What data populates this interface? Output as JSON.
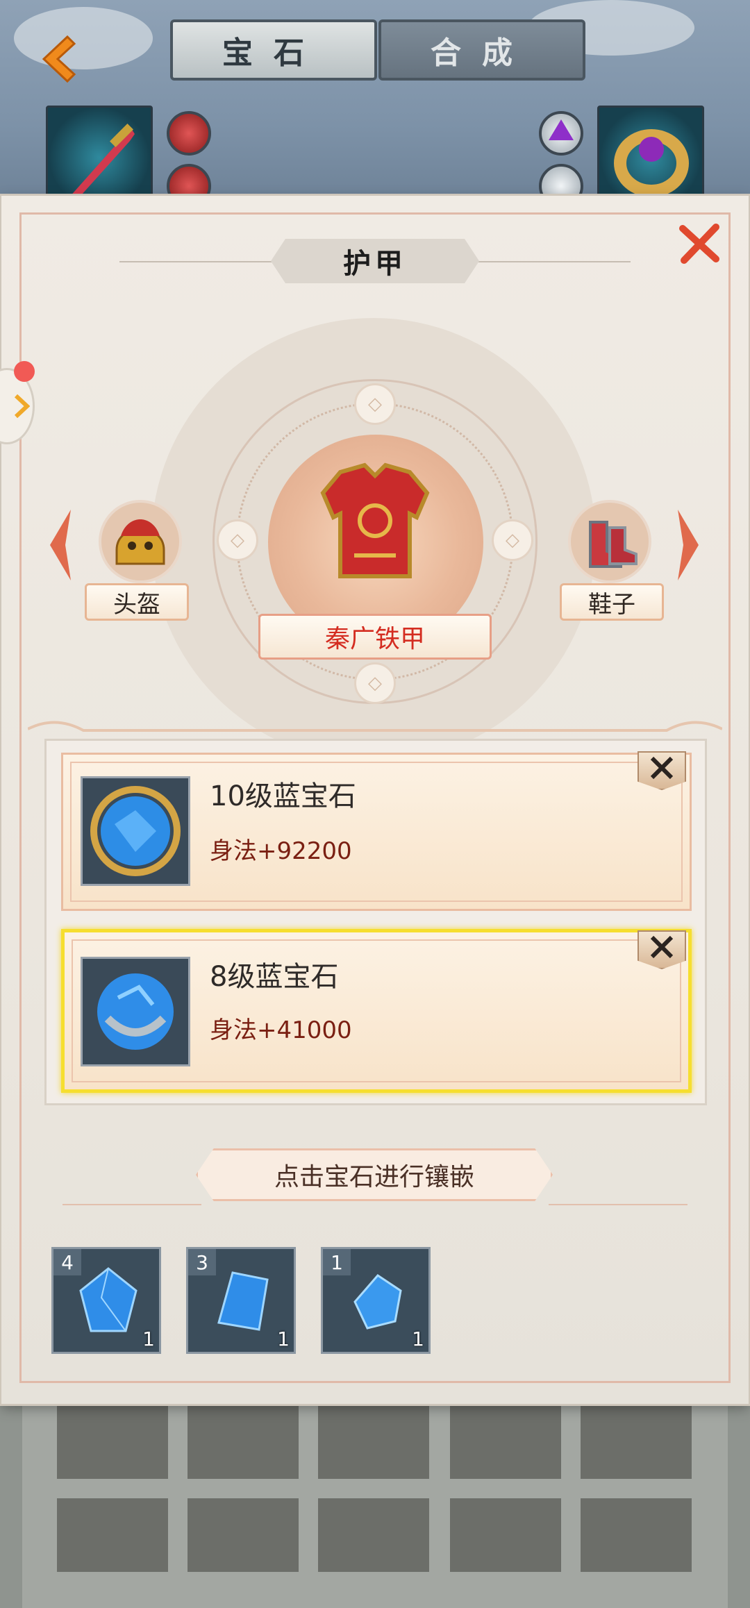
{
  "header": {
    "tabs": [
      {
        "label": "宝石",
        "active": true
      },
      {
        "label": "合成",
        "active": false
      }
    ]
  },
  "panel": {
    "title": "护甲",
    "equipment": {
      "prev": {
        "label": "头盔"
      },
      "current": {
        "label": "秦广铁甲"
      },
      "next": {
        "label": "鞋子"
      }
    },
    "slots": [
      {
        "name": "10级蓝宝石",
        "stat": "身法+92200",
        "selected": false
      },
      {
        "name": "8级蓝宝石",
        "stat": "身法+41000",
        "selected": true
      }
    ],
    "hint": "点击宝石进行镶嵌",
    "inventory": [
      {
        "level": "4",
        "count": "1"
      },
      {
        "level": "3",
        "count": "1"
      },
      {
        "level": "1",
        "count": "1"
      }
    ]
  },
  "colors": {
    "accent_red": "#d42c20",
    "stat_text": "#7a1f12",
    "selected_border": "#f6de2f",
    "gem_blue": "#2f8de8"
  }
}
